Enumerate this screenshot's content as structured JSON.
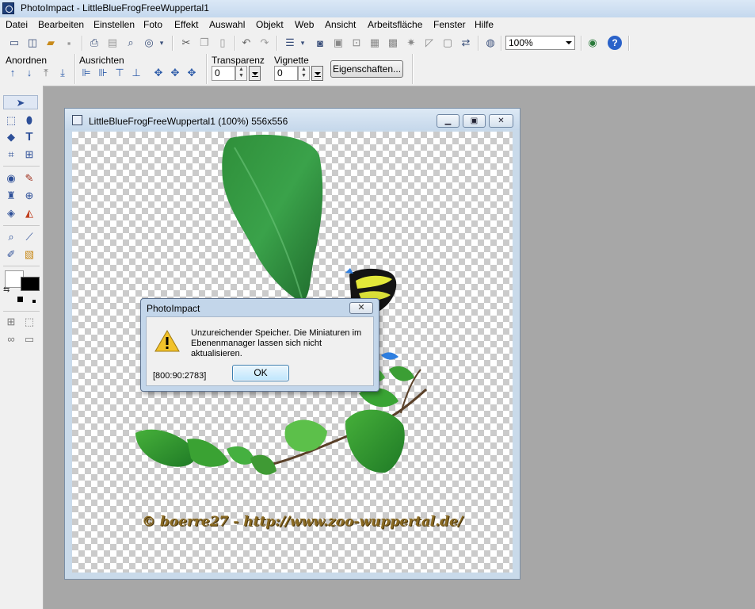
{
  "window": {
    "title": "PhotoImpact - LittleBlueFrogFreeWuppertal1"
  },
  "menu": [
    "Datei",
    "Bearbeiten",
    "Einstellen",
    "Foto",
    "Effekt",
    "Auswahl",
    "Objekt",
    "Web",
    "Ansicht",
    "Arbeitsfläche",
    "Fenster",
    "Hilfe"
  ],
  "toolbar": {
    "zoom": "100%"
  },
  "attributes": {
    "arrange_label": "Anordnen",
    "align_label": "Ausrichten",
    "transparency_label": "Transparenz",
    "transparency_value": "0",
    "vignette_label": "Vignette",
    "vignette_value": "0",
    "properties_button": "Eigenschaften..."
  },
  "document": {
    "title": "LittleBlueFrogFreeWuppertal1 (100%) 556x556",
    "watermark": "© boerre27 - http://www.zoo-wuppertal.de/"
  },
  "dialog": {
    "title": "PhotoImpact",
    "message": "Unzureichender Speicher. Die Miniaturen im\nEbenenmanager lassen sich nicht aktualisieren.",
    "code": "[800:90:2783]",
    "ok": "OK"
  },
  "colors": {
    "title_bar": "#c4d8ee",
    "workspace": "#a7a7a7",
    "dialog_frame": "#c3d6ea"
  }
}
